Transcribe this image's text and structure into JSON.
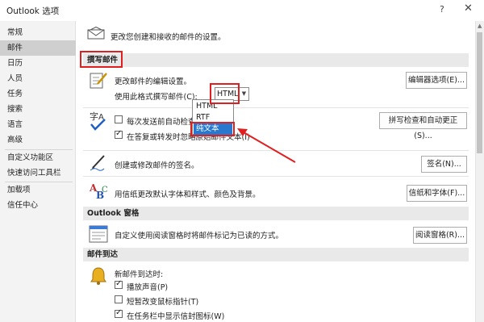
{
  "window": {
    "title": "Outlook 选项",
    "help": "?",
    "close": "✕"
  },
  "sidebar": {
    "items": [
      {
        "label": "常规"
      },
      {
        "label": "邮件"
      },
      {
        "label": "日历"
      },
      {
        "label": "人员"
      },
      {
        "label": "任务"
      },
      {
        "label": "搜索"
      },
      {
        "label": "语言"
      },
      {
        "label": "高级"
      },
      {
        "label": "自定义功能区"
      },
      {
        "label": "快速访问工具栏"
      },
      {
        "label": "加载项"
      },
      {
        "label": "信任中心"
      }
    ],
    "active_index": 1
  },
  "intro": {
    "text": "更改您创建和接收的邮件的设置。"
  },
  "compose": {
    "header": "撰写邮件",
    "edit_settings_text": "更改邮件的编辑设置。",
    "editor_options_button": "编辑器选项(E)...",
    "format_label": "使用此格式撰写邮件(C):",
    "format_value": "HTML",
    "format_options": [
      "HTML",
      "RTF",
      "纯文本"
    ],
    "selected_option": "纯文本",
    "spellcheck_label": "每次发送前自动检查拼",
    "spellcheck_checked": false,
    "ignore_original_label": "在答复或转发时忽略原始邮件文本(I)",
    "ignore_original_checked": true,
    "spelling_button": "拼写检查和自动更正(S)...",
    "signature_text": "创建或修改邮件的签名。",
    "signature_button": "签名(N)...",
    "stationery_text": "用信纸更改默认字体和样式、颜色及背景。",
    "stationery_button": "信纸和字体(F)..."
  },
  "reading_pane": {
    "header": "Outlook 窗格",
    "text": "自定义使用阅读窗格时将邮件标记为已读的方式。",
    "button": "阅读窗格(R)..."
  },
  "arrival": {
    "header": "邮件到达",
    "lead": "新邮件到达时:",
    "options": [
      {
        "label": "播放声音(P)",
        "checked": true
      },
      {
        "label": "短暂改变鼠标指针(T)",
        "checked": false
      },
      {
        "label": "在任务栏中显示信封图标(W)",
        "checked": true
      }
    ]
  },
  "colors": {
    "highlight": "#2878d0",
    "annotation": "#e02020",
    "active_nav": "#cfcfcf"
  }
}
